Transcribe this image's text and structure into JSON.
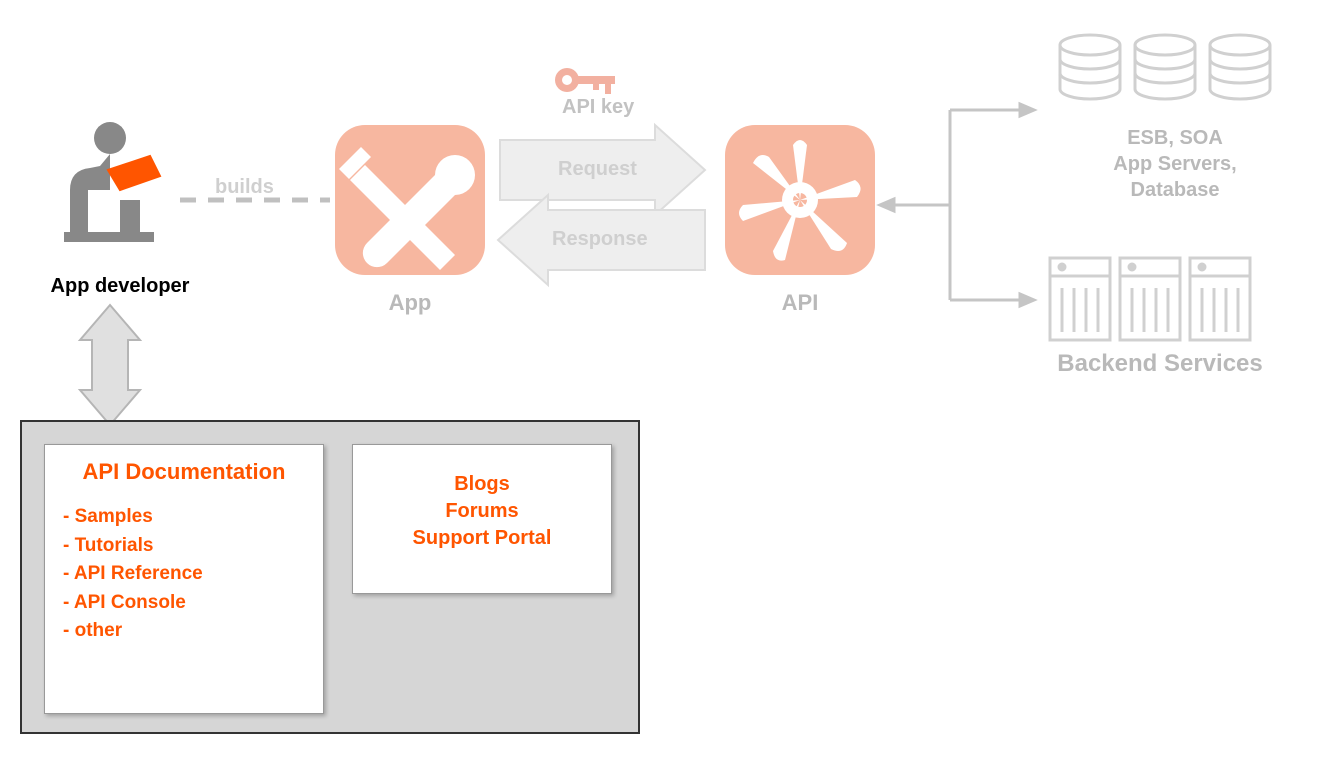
{
  "developer": {
    "label": "App developer"
  },
  "builds": {
    "label": "builds"
  },
  "app": {
    "label": "App"
  },
  "apikey": {
    "label": "API key"
  },
  "request": {
    "label": "Request"
  },
  "response": {
    "label": "Response"
  },
  "api": {
    "label": "API"
  },
  "backend": {
    "title": "Backend Services",
    "top_line1": "ESB, SOA",
    "top_line2": "App Servers,",
    "top_line3": "Database"
  },
  "portal": {
    "docs": {
      "title": "API Documentation",
      "items": [
        "- Samples",
        "- Tutorials",
        "- API Reference",
        "- API Console",
        "- other"
      ]
    },
    "community": {
      "line1": "Blogs",
      "line2": "Forums",
      "line3": "Support Portal"
    }
  }
}
